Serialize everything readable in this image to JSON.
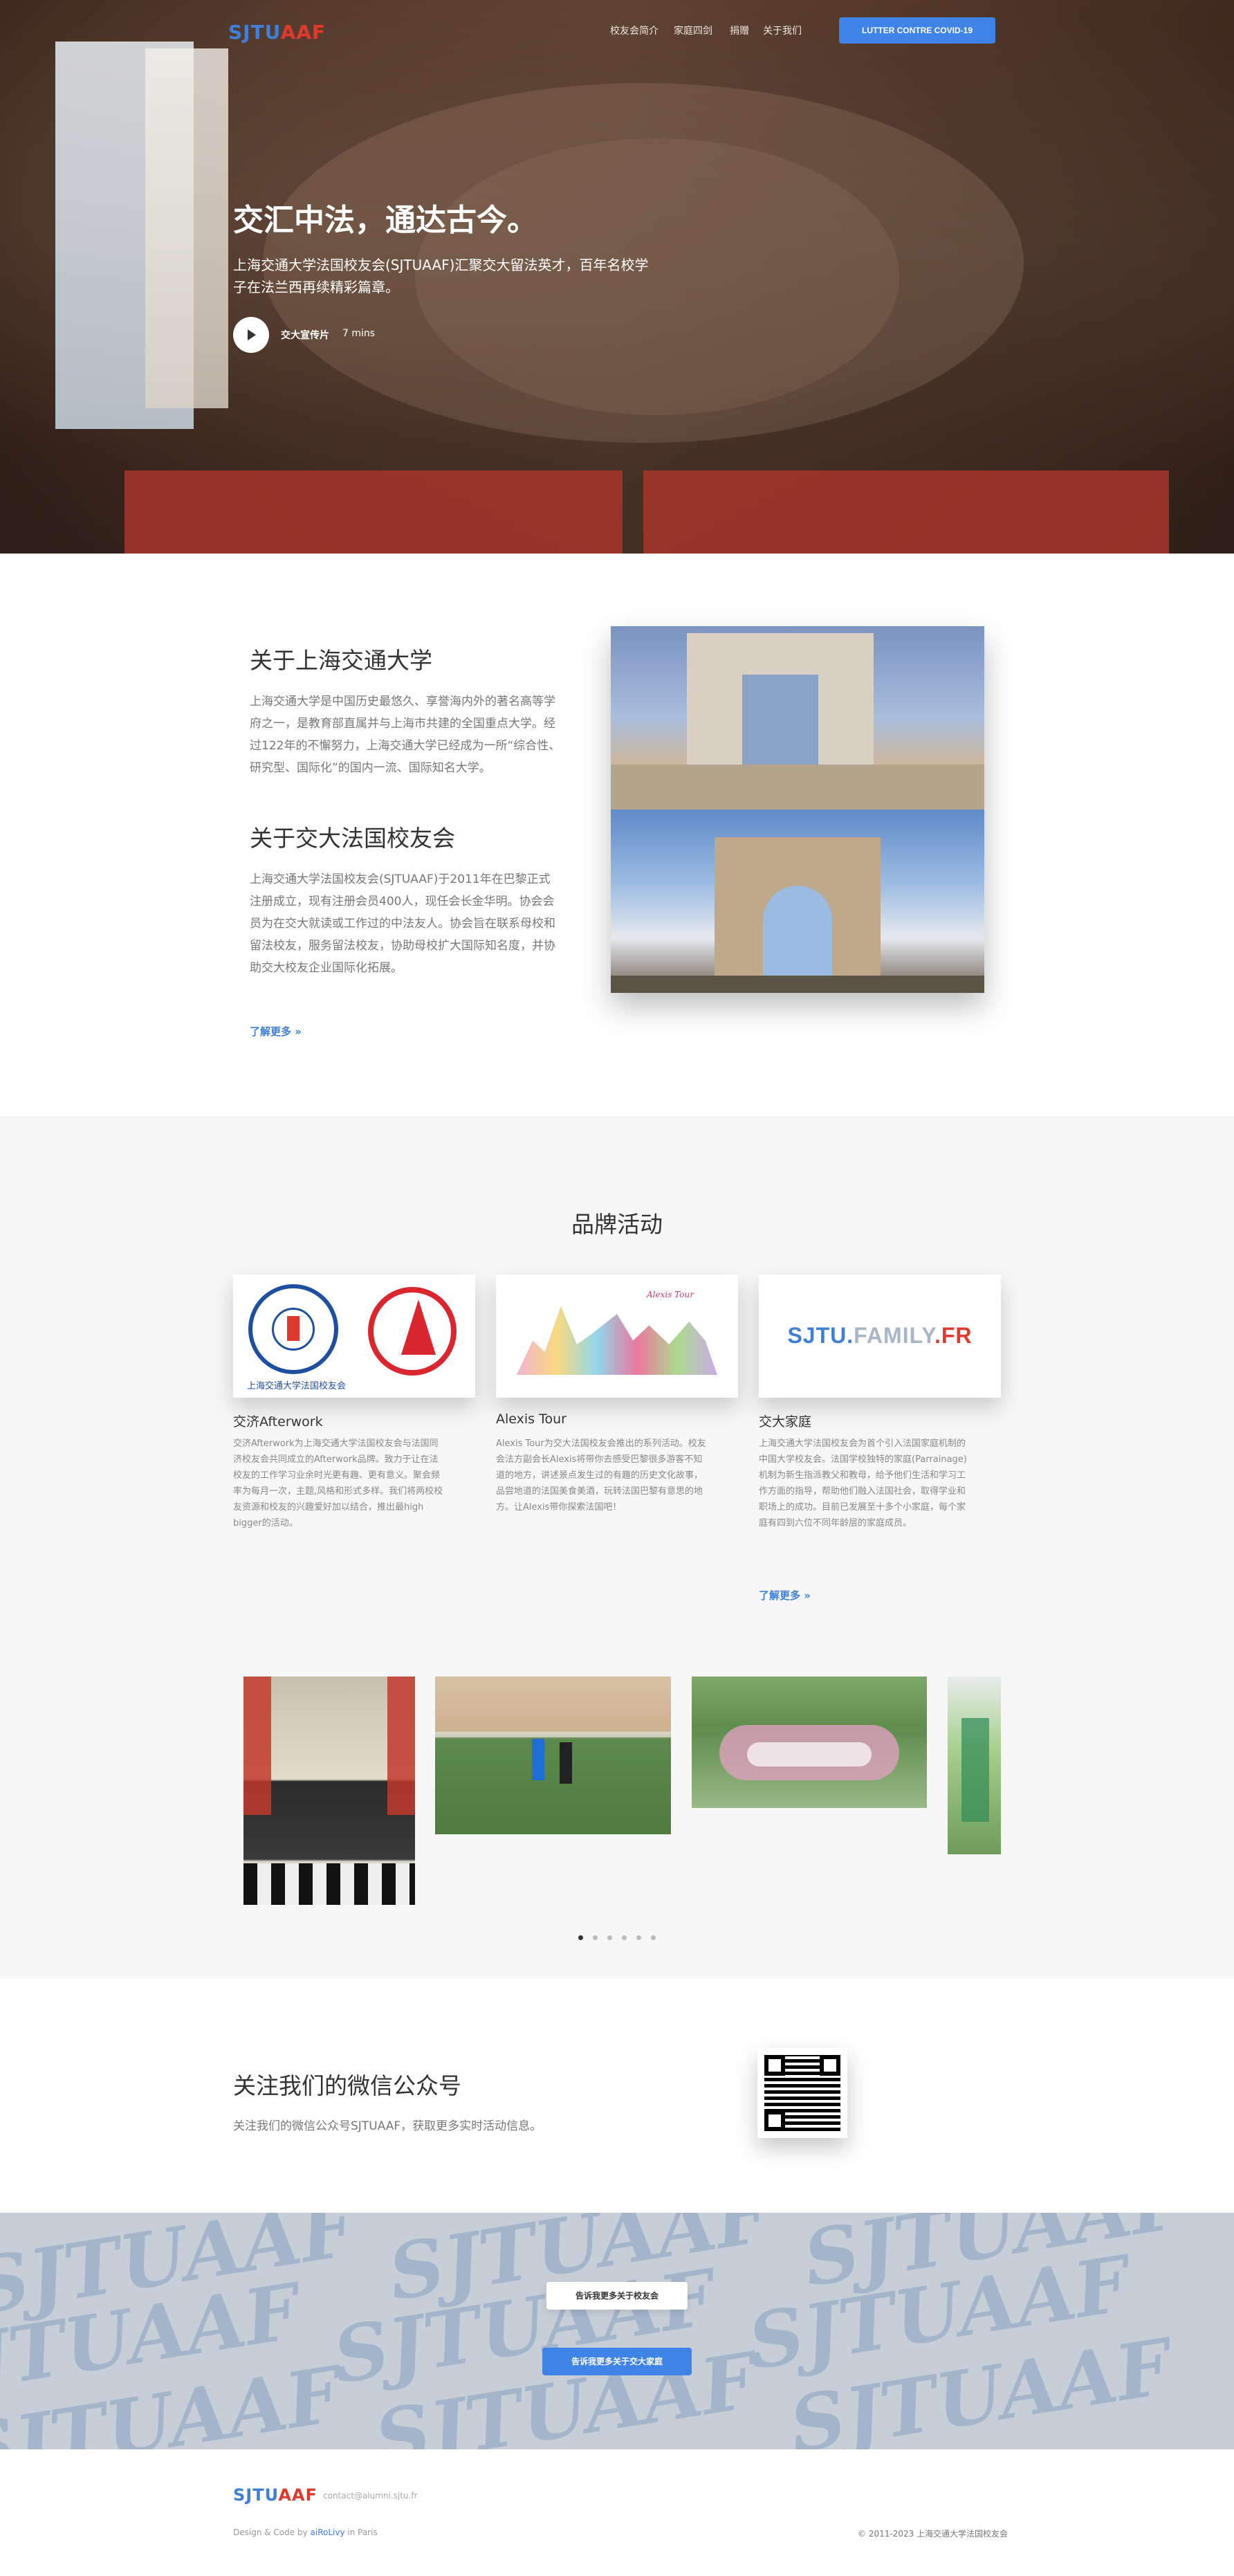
{
  "nav": {
    "logo_part1": "SJTU",
    "logo_part2": "AAF",
    "links": [
      "校友会简介",
      "家庭四剑",
      "捐赠",
      "关于我们"
    ],
    "cta_label": "LUTTER CONTRE COVID-19"
  },
  "hero": {
    "title": "交汇中法，通达古今。",
    "subtitle": "上海交通大学法国校友会(SJTUAAF)汇聚交大留法英才，百年名校学子在法兰西再续精彩篇章。",
    "video_label": "交大宣传片",
    "video_duration": "7 mins"
  },
  "about": {
    "h1": "关于上海交通大学",
    "p1": "上海交通大学是中国历史最悠久、享誉海内外的著名高等学府之一，是教育部直属并与上海市共建的全国重点大学。经过122年的不懈努力，上海交通大学已经成为一所“综合性、研究型、国际化”的国内一流、国际知名大学。",
    "h2": "关于交大法国校友会",
    "p2": "上海交通大学法国校友会(SJTUAAF)于2011年在巴黎正式注册成立，现有注册会员400人，现任会长金华明。协会会员为在交大就读或工作过的中法友人。协会旨在联系母校和留法校友，服务留法校友，协助母校扩大国际知名度，并协助交大校友企业国际化拓展。",
    "more": "了解更多 »"
  },
  "activities": {
    "title": "品牌活动",
    "cards": [
      {
        "title": "交济Afterwork",
        "text": "交济Afterwork为上海交通大学法国校友会与法国同济校友会共同成立的Afterwork品牌。致力于让在法校友的工作学习业余时光更有趣、更有意义。聚会频率为每月一次，主题,风格和形式多样。我们将两校校友资源和校友的兴趣爱好加以结合，推出最high bigger的活动。",
        "logo_caption": "上海交通大学法国校友会"
      },
      {
        "title": "Alexis Tour",
        "text": "Alexis Tour为交大法国校友会推出的系列活动。校友会法方副会长Alexis将带你去感受巴黎很多游客不知道的地方，讲述景点发生过的有趣的历史文化故事，品尝地道的法国美食美酒，玩转法国巴黎有意思的地方。让Alexis带你探索法国吧！",
        "logo_caption": "Alexis Tour"
      },
      {
        "title": "交大家庭",
        "text": "上海交通大学法国校友会为首个引入法国家庭机制的中国大学校友会。法国学校独特的家庭(Parrainage)机制为新生指派教父和教母，给予他们生活和学习工作方面的指导，帮助他们融入法国社会，取得学业和职场上的成功。目前已发展至十多个小家庭，每个家庭有四到六位不同年龄层的家庭成员。",
        "logo_text_1": "SJTU.",
        "logo_text_2": "FAMILY",
        "logo_text_3": ".FR",
        "more": "了解更多 »"
      }
    ]
  },
  "carousel": {
    "active_index": 0,
    "count": 6
  },
  "wechat": {
    "title": "关注我们的微信公众号",
    "text": "关注我们的微信公众号SJTUAAF，获取更多实时活动信息。"
  },
  "cta": {
    "watermark": "SJTUAAF",
    "button1": "告诉我更多关于校友会",
    "button2": "告诉我更多关于交大家庭"
  },
  "footer": {
    "logo_part1": "SJTU",
    "logo_part2": "AAF",
    "email": "contact@alumni.sjtu.fr",
    "credit_prefix": "Design & Code by ",
    "credit_author": "aiRoLivy",
    "credit_suffix": " in Paris",
    "copyright": "© 2011-2023 上海交通大学法国校友会"
  },
  "colors": {
    "accent_blue": "#3f83e6",
    "logo_red": "#e03a2f",
    "logo_blue": "#3f7fd8"
  }
}
